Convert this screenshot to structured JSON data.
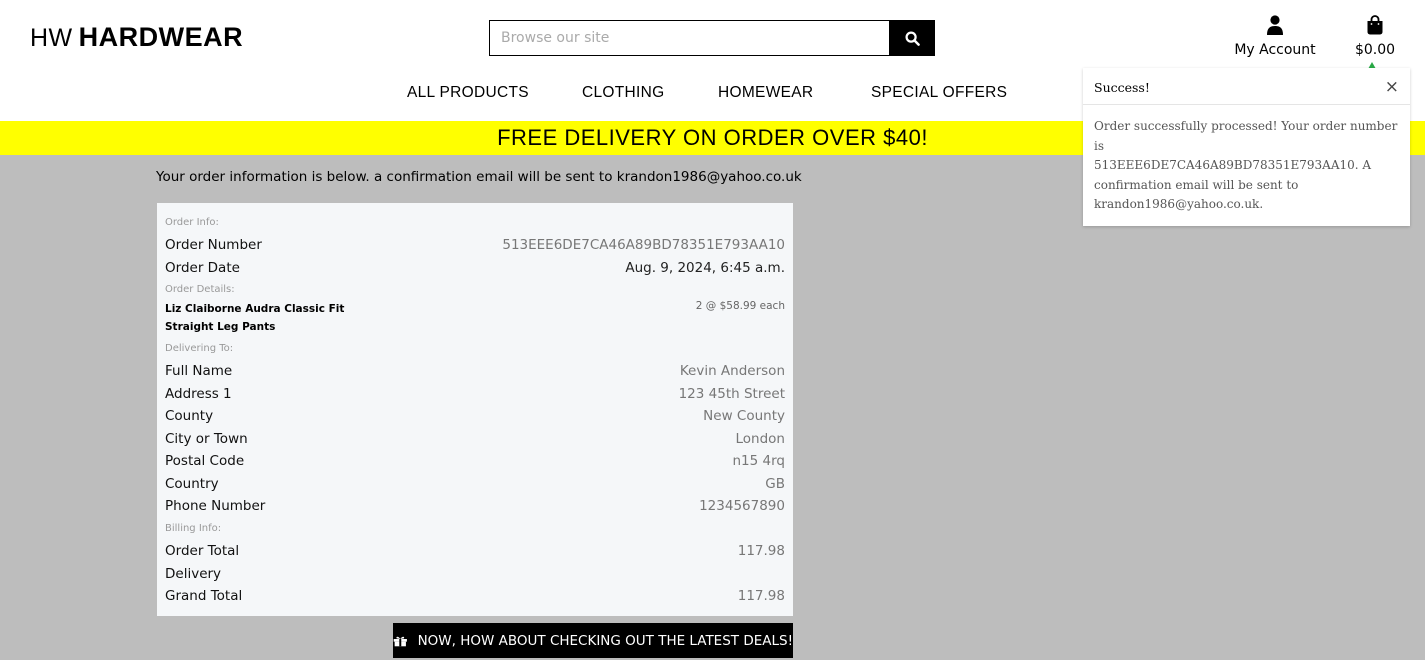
{
  "header": {
    "logo_prefix": "HW",
    "logo_brand": "HARDWEAR",
    "search_placeholder": "Browse our site",
    "account_label": "My Account",
    "bag_total": "$0.00"
  },
  "nav": {
    "items": [
      "ALL PRODUCTS",
      "CLOTHING",
      "HOMEWEAR",
      "SPECIAL OFFERS"
    ]
  },
  "banner": "FREE DELIVERY ON ORDER OVER $40!",
  "intro": {
    "text": "Your order information is below. a confirmation email will be sent to",
    "email": "krandon1986@yahoo.co.uk"
  },
  "order": {
    "info_label": "Order Info:",
    "number_label": "Order Number",
    "number": "513EEE6DE7CA46A89BD78351E793AA10",
    "date_label": "Order Date",
    "date": "Aug. 9, 2024, 6:45 a.m.",
    "details_label": "Order Details:",
    "item_name": "Liz Claiborne Audra Classic Fit Straight Leg Pants",
    "item_qty": "2 @ $58.99 each",
    "delivery_label": "Delivering To:",
    "full_name_label": "Full Name",
    "full_name": "Kevin Anderson",
    "address1_label": "Address 1",
    "address1": "123 45th Street",
    "county_label": "County",
    "county": "New County",
    "city_label": "City or Town",
    "city": "London",
    "postal_label": "Postal Code",
    "postal": "n15 4rq",
    "country_label": "Country",
    "country": "GB",
    "phone_label": "Phone Number",
    "phone": "1234567890",
    "billing_label": "Billing Info:",
    "order_total_label": "Order Total",
    "order_total": "117.98",
    "delivery_cost_label": "Delivery",
    "grand_total_label": "Grand Total",
    "grand_total": "117.98"
  },
  "deals_button": "NOW, HOW ABOUT CHECKING OUT THE LATEST DEALS!",
  "toast": {
    "title": "Success!",
    "close": "×",
    "line1": "Order successfully processed! Your order number is",
    "line2": "513EEE6DE7CA46A89BD78351E793AA10. A",
    "line3": "confirmation email will be sent to",
    "line4": "krandon1986@yahoo.co.uk."
  },
  "colors": {
    "banner": "#ffff00",
    "toast_accent": "#28a745",
    "page_bg": "#bdbdbd"
  }
}
